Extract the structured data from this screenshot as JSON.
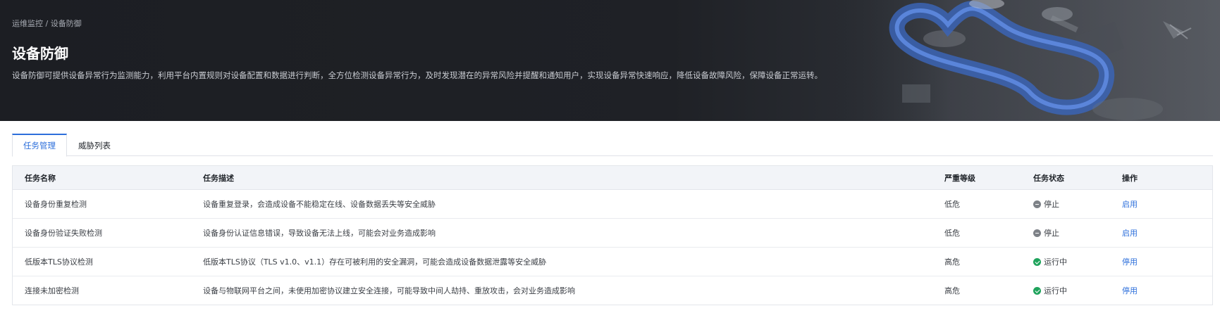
{
  "breadcrumb": {
    "parent": "运维监控",
    "separator": " / ",
    "current": "设备防御"
  },
  "header": {
    "title": "设备防御",
    "description": "设备防御可提供设备异常行为监测能力，利用平台内置规则对设备配置和数据进行判断，全方位检测设备异常行为，及时发现潜在的异常风险并提醒和通知用户，实现设备异常快速响应，降低设备故障风险，保障设备正常运转。"
  },
  "tabs": [
    {
      "label": "任务管理",
      "active": true
    },
    {
      "label": "威胁列表",
      "active": false
    }
  ],
  "table": {
    "columns": [
      "任务名称",
      "任务描述",
      "严重等级",
      "任务状态",
      "操作"
    ],
    "rows": [
      {
        "name": "设备身份重复检测",
        "desc": "设备重复登录，会造成设备不能稳定在线、设备数据丢失等安全威胁",
        "level": "低危",
        "status": "停止",
        "status_icon": "stop-icon",
        "action": "启用"
      },
      {
        "name": "设备身份验证失败检测",
        "desc": "设备身份认证信息错误，导致设备无法上线，可能会对业务造成影响",
        "level": "低危",
        "status": "停止",
        "status_icon": "stop-icon",
        "action": "启用"
      },
      {
        "name": "低版本TLS协议检测",
        "desc": "低版本TLS协议（TLS v1.0、v1.1）存在可被利用的安全漏洞，可能会造成设备数据泄露等安全威胁",
        "level": "高危",
        "status": "运行中",
        "status_icon": "check-icon",
        "action": "停用"
      },
      {
        "name": "连接未加密检测",
        "desc": "设备与物联网平台之间，未使用加密协议建立安全连接，可能导致中间人劫持、重放攻击，会对业务造成影响",
        "level": "高危",
        "status": "运行中",
        "status_icon": "check-icon",
        "action": "停用"
      }
    ]
  },
  "colors": {
    "accent": "#2d6fdb",
    "running": "#1fa35c",
    "stopped": "#7d8187",
    "header_bg": "#1f2126"
  }
}
